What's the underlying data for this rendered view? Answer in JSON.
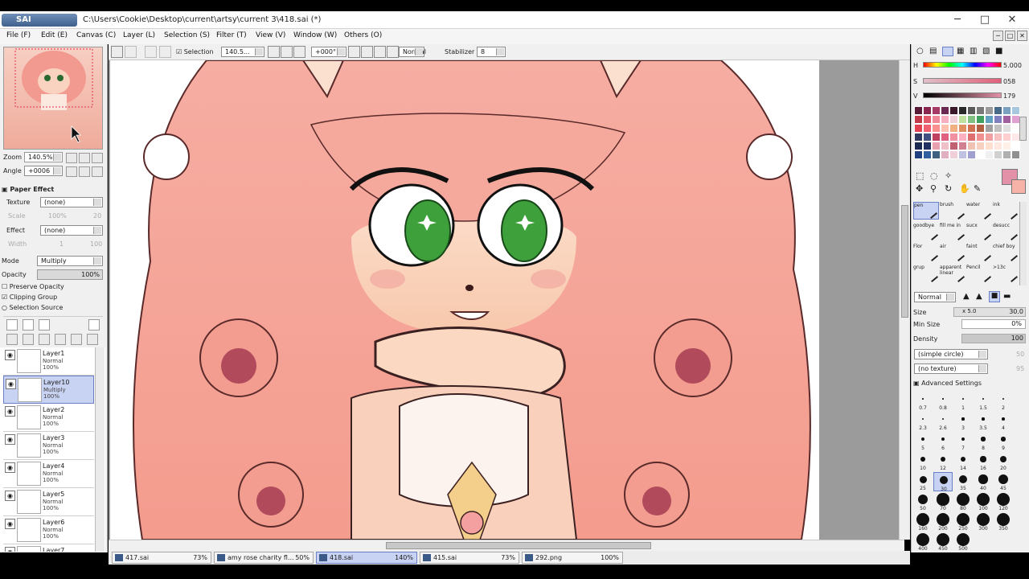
{
  "window": {
    "app_name": "SAI",
    "title": "C:\\Users\\Cookie\\Desktop\\current\\artsy\\current 3\\418.sai (*)",
    "minimize": "─",
    "maximize": "□",
    "close": "✕"
  },
  "menu": [
    "File (F)",
    "Edit (E)",
    "Canvas (C)",
    "Layer (L)",
    "Selection (S)",
    "Filter (T)",
    "View (V)",
    "Window (W)",
    "Others (O)"
  ],
  "toolbar": {
    "selection_label": "Selection",
    "zoom_value": "140.5...",
    "rotation_value": "+000°",
    "blend_mode": "Normal",
    "stabilizer_label": "Stabilizer",
    "stabilizer_value": "8"
  },
  "navigator": {
    "zoom_label": "Zoom",
    "zoom_value": "140.5%",
    "angle_label": "Angle",
    "angle_value": "+0006"
  },
  "paper_effect": {
    "section_label": "Paper Effect",
    "texture_label": "Texture",
    "texture_value": "(none)",
    "scale_label": "Scale",
    "scale_value": "100%",
    "scale_num": "20",
    "effect_label": "Effect",
    "effect_value": "(none)",
    "width_label": "Width",
    "width_value": "1",
    "width_num": "100"
  },
  "layer_props": {
    "mode_label": "Mode",
    "mode_value": "Multiply",
    "opacity_label": "Opacity",
    "opacity_value": "100%",
    "opacity_fraction": 1.0,
    "preserve_opacity": "Preserve Opacity",
    "clipping_group": "Clipping Group",
    "selection_source": "Selection Source"
  },
  "layers": [
    {
      "name": "Layer1",
      "mode": "Normal",
      "opacity": "100%",
      "selected": false
    },
    {
      "name": "Layer10",
      "mode": "Multiply",
      "opacity": "100%",
      "selected": true
    },
    {
      "name": "Layer2",
      "mode": "Normal",
      "opacity": "100%",
      "selected": false
    },
    {
      "name": "Layer3",
      "mode": "Normal",
      "opacity": "100%",
      "selected": false
    },
    {
      "name": "Layer4",
      "mode": "Normal",
      "opacity": "100%",
      "selected": false
    },
    {
      "name": "Layer5",
      "mode": "Normal",
      "opacity": "100%",
      "selected": false
    },
    {
      "name": "Layer6",
      "mode": "Normal",
      "opacity": "100%",
      "selected": false
    },
    {
      "name": "Layer7",
      "mode": "",
      "opacity": "",
      "selected": false
    }
  ],
  "color": {
    "h_label": "H",
    "s_label": "S",
    "v_label": "V",
    "h_value": "5.000",
    "s_value": "058",
    "v_value": "179",
    "main_color": "#e391a8",
    "sub_color": "#f7b3a8",
    "swatches": [
      "#5b1a35",
      "#8a2550",
      "#a63a66",
      "#6b2a52",
      "#3a1a2a",
      "#2a2a2a",
      "#5a5a5a",
      "#7a7a7a",
      "#9a9a9a",
      "#4a6a8a",
      "#7aa0c0",
      "#a8c8e0",
      "#c23a4a",
      "#e05a6a",
      "#f08a9a",
      "#f8b0c0",
      "#f0d0d8",
      "#c0e0a0",
      "#80c080",
      "#40a060",
      "#60a0c0",
      "#8080c0",
      "#a060a0",
      "#e0a0d0",
      "#e04050",
      "#f06070",
      "#f89090",
      "#ffc0b0",
      "#f0b080",
      "#e09060",
      "#d07050",
      "#b06040",
      "#a0a0a0",
      "#c0c0c0",
      "#e0e0e0",
      "#ffffff",
      "#303a60",
      "#405080",
      "#c04060",
      "#e06080",
      "#f090a0",
      "#ffb0c0",
      "#e07070",
      "#f09090",
      "#f0a0a0",
      "#f8c0c0",
      "#ffd0d0",
      "#ffe8e8",
      "#1a2a50",
      "#203060",
      "#e8a0b0",
      "#f0c0c8",
      "#c06070",
      "#d08090",
      "#f0c0b0",
      "#f8d0c0",
      "#ffe0d0",
      "#ffe8e0",
      "#fff0e8",
      "#ffffff",
      "#204080",
      "#3060a0",
      "#406080",
      "#e0b0c0",
      "#f0d0d8",
      "#c0c0e0",
      "#a0a0d0",
      "#ffffff",
      "#f0f0f0",
      "#d0d0d0",
      "#b0b0b0",
      "#909090"
    ]
  },
  "tools": [
    {
      "name": "pen",
      "selected": true
    },
    {
      "name": "brush",
      "selected": false
    },
    {
      "name": "water",
      "selected": false
    },
    {
      "name": "ink",
      "selected": false
    },
    {
      "name": "goodbye",
      "selected": false
    },
    {
      "name": "fill me in",
      "selected": false
    },
    {
      "name": "sucx",
      "selected": false
    },
    {
      "name": "desucc",
      "selected": false
    },
    {
      "name": "Flor",
      "selected": false
    },
    {
      "name": "air",
      "selected": false
    },
    {
      "name": "faint",
      "selected": false
    },
    {
      "name": "chief boy",
      "selected": false
    },
    {
      "name": "grup",
      "selected": false
    },
    {
      "name": "apparent linear",
      "selected": false
    },
    {
      "name": "Pencil",
      "selected": false
    },
    {
      "name": ">13c",
      "selected": false
    }
  ],
  "brush_settings": {
    "mode": "Normal",
    "size_label": "Size",
    "size_mult": "x 5.0",
    "size_value": "30.0",
    "min_size_label": "Min Size",
    "min_size_value": "0%",
    "density_label": "Density",
    "density_value": "100",
    "shape_value": "(simple circle)",
    "shape_num": "50",
    "texture_value": "(no texture)",
    "texture_num": "95",
    "advanced_label": "Advanced Settings"
  },
  "brush_sizes": [
    "0.7",
    "0.8",
    "1",
    "1.5",
    "2",
    "2.3",
    "2.6",
    "3",
    "3.5",
    "4",
    "5",
    "6",
    "7",
    "8",
    "9",
    "10",
    "12",
    "14",
    "16",
    "20",
    "25",
    "30",
    "35",
    "40",
    "45",
    "50",
    "70",
    "80",
    "100",
    "120",
    "160",
    "200",
    "250",
    "300",
    "350",
    "400",
    "450",
    "500"
  ],
  "brush_size_selected": "30",
  "doc_tabs": [
    {
      "name": "417.sai",
      "zoom": "73%",
      "active": false
    },
    {
      "name": "amy rose charity fl...",
      "zoom": "50%",
      "active": false
    },
    {
      "name": "418.sai",
      "zoom": "140%",
      "active": true
    },
    {
      "name": "415.sai",
      "zoom": "73%",
      "active": false
    },
    {
      "name": "292.png",
      "zoom": "100%",
      "active": false
    }
  ]
}
